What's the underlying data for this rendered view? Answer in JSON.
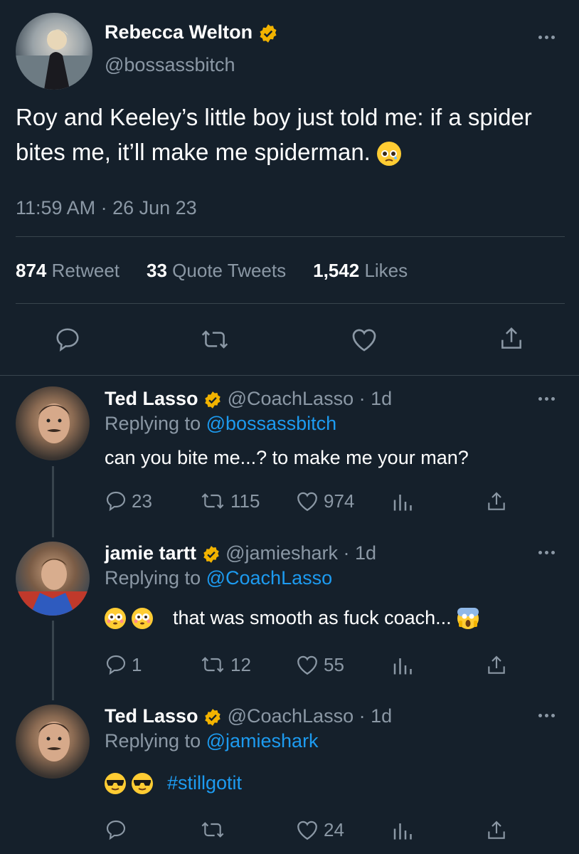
{
  "tweet": {
    "author_name": "Rebecca Welton",
    "handle": "@bossassbitch",
    "text": "Roy and Keeley’s little boy just told me: if a spider bites me, it’ll make me spiderman.",
    "timestamp": "11:59 AM · 26 Jun 23",
    "stats": {
      "retweets_count": "874",
      "retweets_label": "Retweet",
      "quotes_count": "33",
      "quotes_label": "Quote Tweets",
      "likes_count": "1,542",
      "likes_label": "Likes"
    }
  },
  "replies": [
    {
      "author_name": "Ted Lasso",
      "handle_time": "@CoachLasso · 1d",
      "replying_prefix": "Replying to",
      "replying_to": "@bossassbitch",
      "text": "can you bite me...? to make me your man?",
      "comments": "23",
      "retweets": "115",
      "likes": "974"
    },
    {
      "author_name": "jamie tartt",
      "handle_time": "@jamieshark · 1d",
      "replying_prefix": "Replying to",
      "replying_to": "@CoachLasso",
      "text": "that was smooth as fuck coach...",
      "comments": "1",
      "retweets": "12",
      "likes": "55"
    },
    {
      "author_name": "Ted Lasso",
      "handle_time": "@CoachLasso · 1d",
      "replying_prefix": "Replying to",
      "replying_to": "@jamieshark",
      "text": "#stillgotit",
      "comments": "",
      "retweets": "",
      "likes": "24"
    }
  ],
  "icons": {
    "verified": "verified-badge-icon",
    "more": "more-options-icon",
    "reply": "reply-icon",
    "retweet": "retweet-icon",
    "like": "like-icon",
    "share": "share-icon",
    "analytics": "analytics-icon"
  },
  "colors": {
    "background": "#15202b",
    "text": "#ffffff",
    "muted": "#8b98a5",
    "link": "#1d9bf0",
    "verified": "#f2b300",
    "divider": "#38444d"
  }
}
